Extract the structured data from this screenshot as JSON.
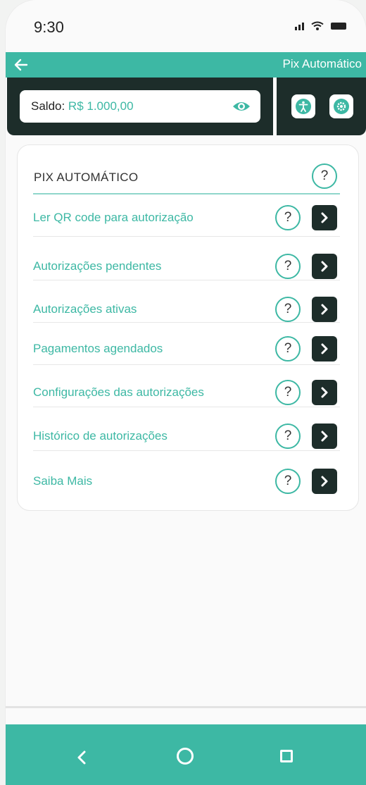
{
  "status_bar": {
    "time": "9:30"
  },
  "header": {
    "title": "Pix Automático"
  },
  "balance": {
    "label": "Saldo:",
    "value": " R$ 1.000,00"
  },
  "card": {
    "title": "PIX AUTOMÁTICO",
    "help_symbol": "?",
    "items": [
      {
        "label": "Ler QR code para autorização"
      },
      {
        "label": "Autorizações pendentes"
      },
      {
        "label": "Autorizações ativas"
      },
      {
        "label": "Pagamentos agendados"
      },
      {
        "label": "Configurações das autorizações"
      },
      {
        "label": "Histórico de autorizações"
      },
      {
        "label": "Saiba Mais"
      }
    ]
  },
  "icons": {
    "back": "arrow-left-icon",
    "eye": "eye-icon",
    "accessibility": "accessibility-icon",
    "settings": "gear-icon",
    "help": "question-icon",
    "arrow": "chevron-right-icon"
  },
  "colors": {
    "accent": "#3db8a4",
    "dark": "#1d2d2a"
  }
}
